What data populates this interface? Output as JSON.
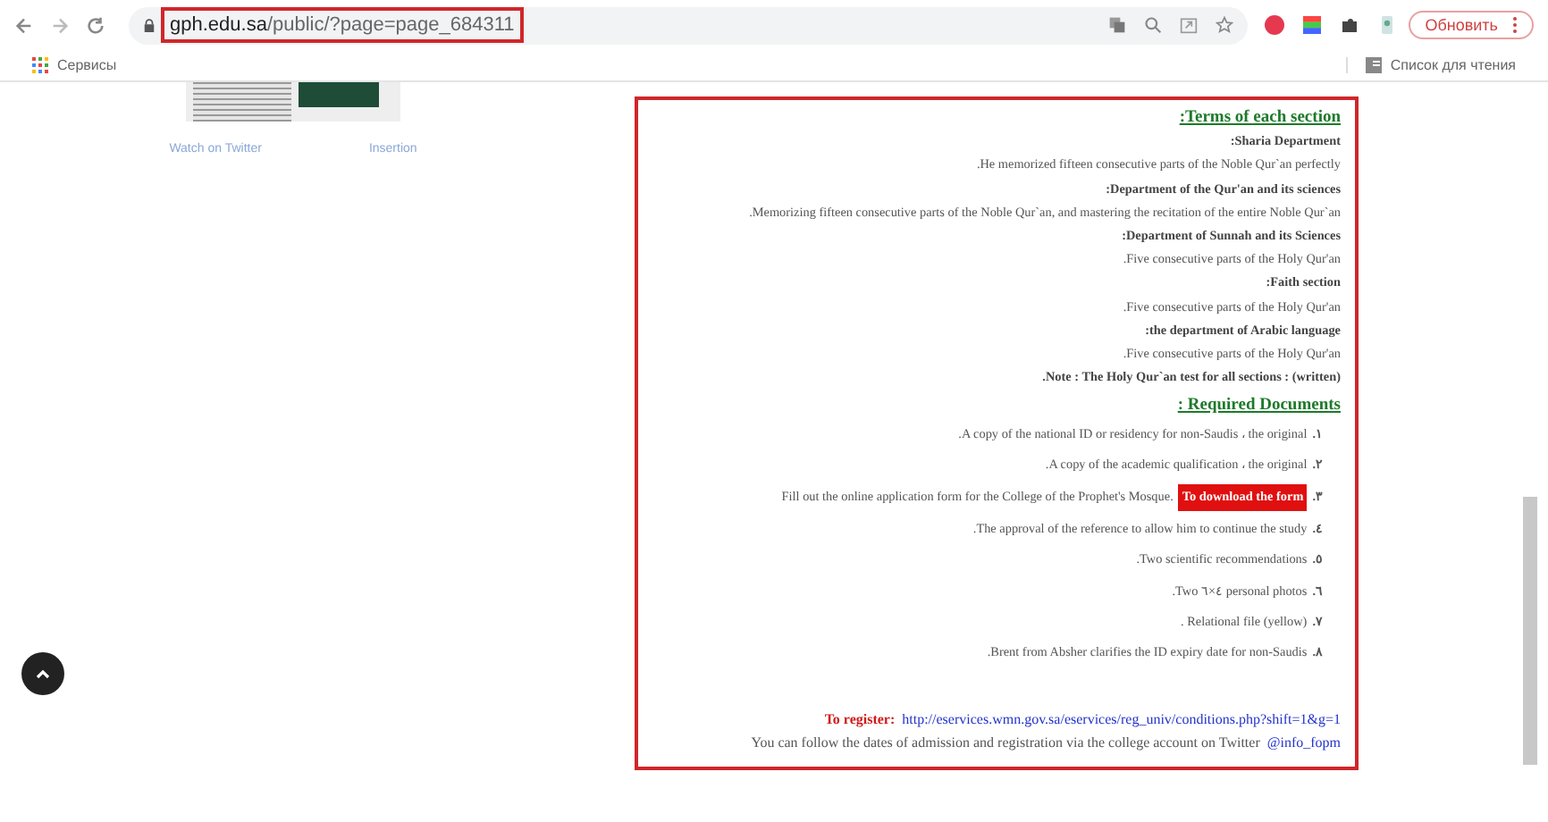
{
  "browser": {
    "address": {
      "domain": "gph.edu.sa",
      "path": "/public/?page=page_684311"
    },
    "update_button": "Обновить",
    "bookmarks": [
      {
        "label": "Сервисы"
      }
    ],
    "reading_list": "Список для чтения"
  },
  "left_panel": {
    "links": [
      "Watch on Twitter",
      "Insertion"
    ]
  },
  "terms": {
    "heading": ":Terms of each section",
    "sections": [
      {
        "title": ":Sharia Department",
        "text": ".He memorized fifteen consecutive parts of the Noble Qur`an perfectly"
      },
      {
        "title": ":Department of the Qur'an and its sciences",
        "text": ".Memorizing fifteen consecutive parts of the Noble Qur`an, and mastering the recitation of the entire Noble Qur`an"
      },
      {
        "title": ":Department of Sunnah and its Sciences",
        "text": ".Five consecutive parts of the Holy Qur'an"
      },
      {
        "title": ":Faith section",
        "text": ".Five consecutive parts of the Holy Qur'an"
      },
      {
        "title": ":the department of Arabic language",
        "text": ".Five consecutive parts of the Holy Qur'an"
      }
    ],
    "note": ".Note : The Holy Qur`an test for all sections : (written)"
  },
  "documents": {
    "heading": ": Required Documents",
    "items": [
      {
        "number": ".١",
        "text": ".A copy of the national ID or residency for non-Saudis ، the original"
      },
      {
        "number": ".٢",
        "text": ".A copy of the academic qualification ، the original"
      },
      {
        "number": ".٣",
        "text": "Fill out the online application form for the College of the Prophet's Mosque.",
        "link": "To download the form"
      },
      {
        "number": ".٤",
        "text": ".The approval of the reference to allow him to continue the study"
      },
      {
        "number": ".٥",
        "text": ".Two scientific recommendations"
      },
      {
        "number": ".٦",
        "text": ".Two ٤×٦ personal photos"
      },
      {
        "number": ".٧",
        "text": ". Relational file (yellow)"
      },
      {
        "number": ".٨",
        "text": ".Brent from Absher clarifies the ID expiry date for non-Saudis"
      }
    ]
  },
  "register": {
    "label": "To register:",
    "url": "http://eservices.wmn.gov.sa/eservices/reg_univ/conditions.php?shift=1&g=1"
  },
  "twitter": {
    "text": "You can follow the dates of admission and registration via the college account on Twitter",
    "handle": "@info_fopm"
  }
}
